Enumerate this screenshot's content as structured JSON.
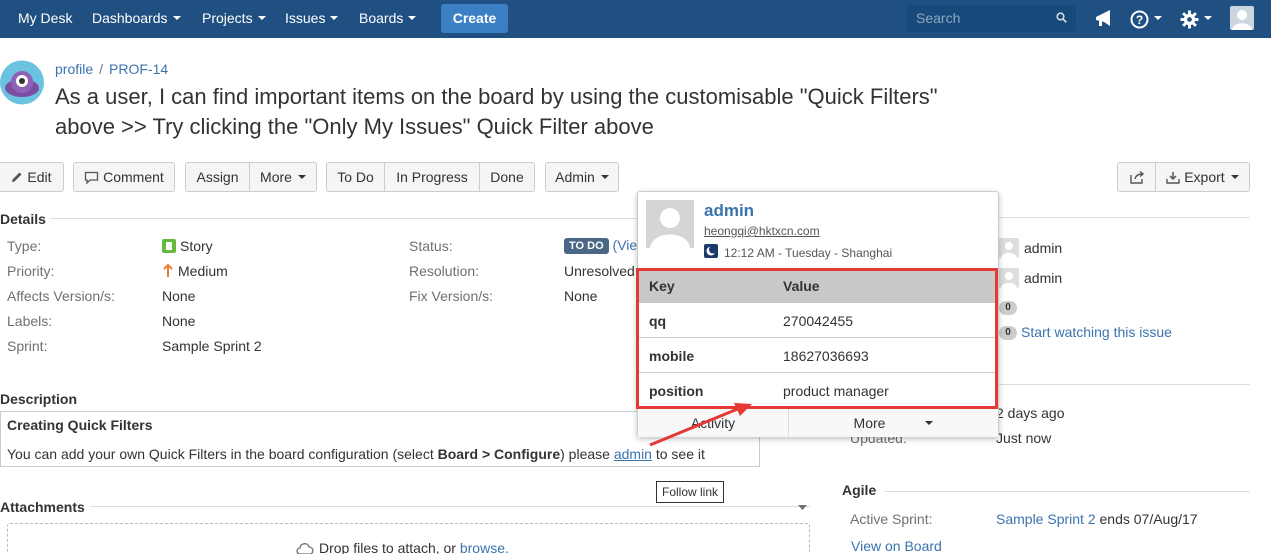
{
  "nav": {
    "my_desk": "My Desk",
    "dashboards": "Dashboards",
    "projects": "Projects",
    "issues": "Issues",
    "boards": "Boards",
    "create": "Create",
    "search_placeholder": "Search"
  },
  "header": {
    "breadcrumb_project": "profile",
    "breadcrumb_sep": "/",
    "breadcrumb_issue": "PROF-14",
    "title_line1": "As a user, I can find important items on the board by using the customisable \"Quick Filters\"",
    "title_line2": "above >> Try clicking the \"Only My Issues\" Quick Filter above"
  },
  "toolbar": {
    "edit": "Edit",
    "comment": "Comment",
    "assign": "Assign",
    "more": "More",
    "todo": "To Do",
    "in_progress": "In Progress",
    "done": "Done",
    "admin": "Admin",
    "export": "Export"
  },
  "details": {
    "title": "Details",
    "type_label": "Type:",
    "type_value": "Story",
    "priority_label": "Priority:",
    "priority_value": "Medium",
    "affects_label": "Affects Version/s:",
    "affects_value": "None",
    "labels_label": "Labels:",
    "labels_value": "None",
    "sprint_label": "Sprint:",
    "sprint_value": "Sample Sprint 2",
    "status_label": "Status:",
    "status_value": "TO DO",
    "status_link": "(Vie",
    "resolution_label": "Resolution:",
    "resolution_value": "Unresolved",
    "fix_label": "Fix Version/s:",
    "fix_value": "None"
  },
  "description": {
    "title": "Description",
    "heading": "Creating Quick Filters",
    "text_pre": "You can add your own Quick Filters in the board configuration (select ",
    "text_bold": "Board > Configure",
    "text_mid": ")   please ",
    "text_link": "admin",
    "text_post": " to see it"
  },
  "tooltip": "Follow link",
  "attachments": {
    "title": "Attachments",
    "drop_text": "Drop files to attach, or ",
    "browse": "browse."
  },
  "user_card": {
    "name": "admin",
    "email": "heongqi@hktxcn.com",
    "time": "12:12 AM - Tuesday - Shanghai",
    "table_header_key": "Key",
    "table_header_value": "Value",
    "rows": [
      {
        "key": "qq",
        "value": "270042455"
      },
      {
        "key": "mobile",
        "value": "18627036693"
      },
      {
        "key": "position",
        "value": "product manager"
      }
    ],
    "activity": "Activity",
    "more": "More"
  },
  "people": {
    "assignee": "admin",
    "reporter": "admin",
    "votes": "0",
    "watchers": "0",
    "watch_link": "Start watching this issue"
  },
  "dates": {
    "created_value": "2 days ago",
    "updated_label": "Updated:",
    "updated_value": "Just now"
  },
  "agile": {
    "title": "Agile",
    "active_sprint_label": "Active Sprint:",
    "sprint_link": "Sample Sprint 2",
    "ends": "ends 07/Aug/17",
    "view_board": "View on Board"
  },
  "colors": {
    "nav_bg": "#205081",
    "create_btn": "#3b7fc4",
    "link": "#3b73af",
    "highlight": "#e53935",
    "lozenge": "#4a6785"
  }
}
